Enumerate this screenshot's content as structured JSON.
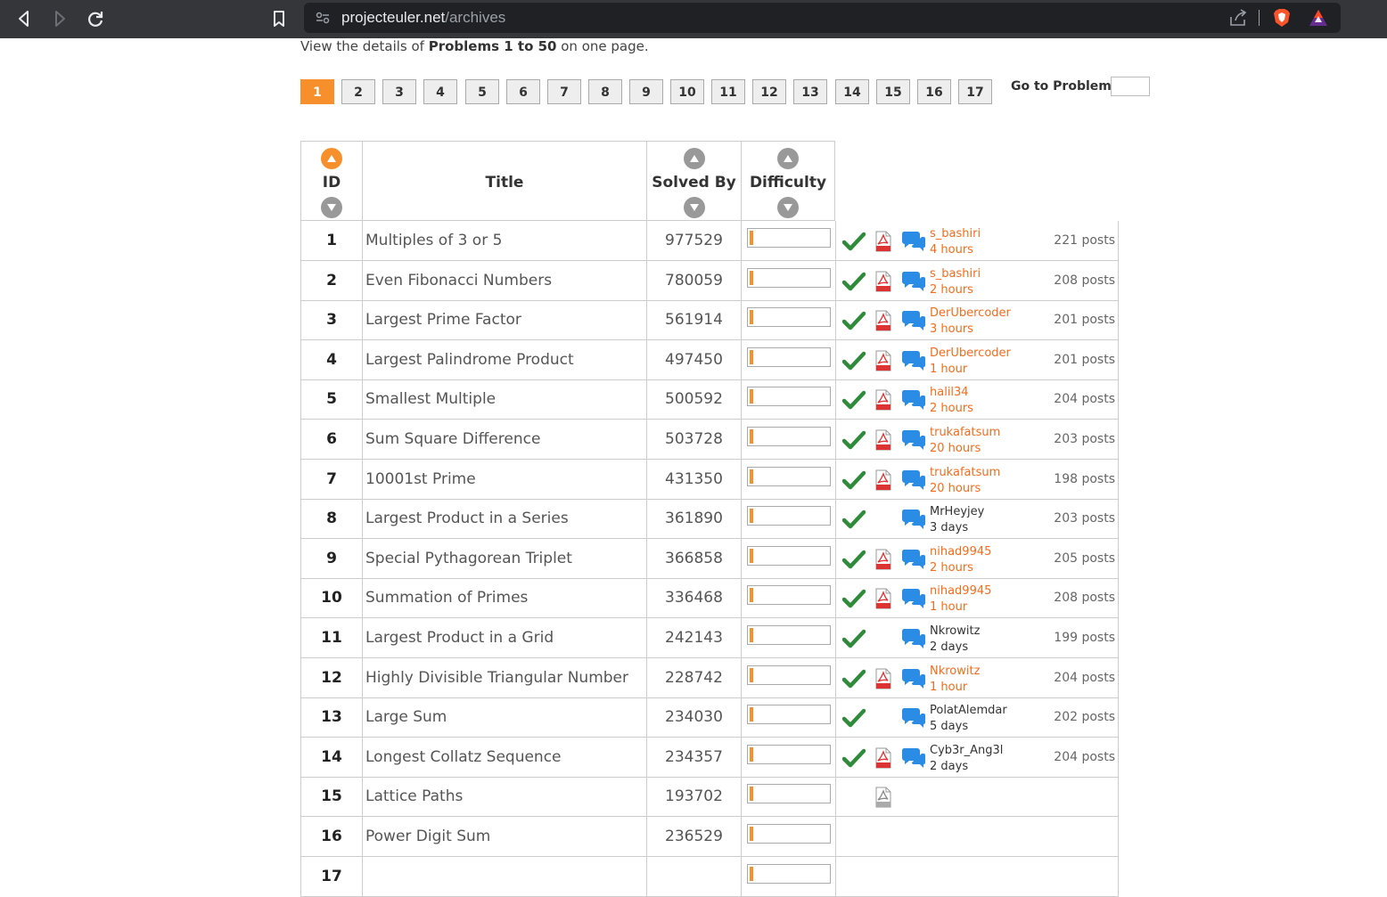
{
  "browser": {
    "url_host": "projecteuler.net",
    "url_path": "/archives"
  },
  "intro": {
    "prefix": "View the details of ",
    "bold": "Problems 1 to 50",
    "suffix": " on one page."
  },
  "pagination": {
    "pages": [
      "1",
      "2",
      "3",
      "4",
      "5",
      "6",
      "7",
      "8",
      "9",
      "10",
      "11",
      "12",
      "13",
      "14",
      "15",
      "16",
      "17"
    ],
    "active": "1",
    "goto_label": "Go to Problem:",
    "accent": "#f7902c"
  },
  "table": {
    "headers": {
      "id": "ID",
      "title": "Title",
      "solved_by": "Solved By",
      "difficulty": "Difficulty"
    },
    "rows": [
      {
        "id": "1",
        "title": "Multiples of 3 or 5",
        "solved": "977529",
        "difficulty": 0.05,
        "solved_mark": true,
        "pdf": true,
        "forum": true,
        "user": "s_bashiri",
        "time": "4 hours",
        "recent": true,
        "posts": "221 posts"
      },
      {
        "id": "2",
        "title": "Even Fibonacci Numbers",
        "solved": "780059",
        "difficulty": 0.05,
        "solved_mark": true,
        "pdf": true,
        "forum": true,
        "user": "s_bashiri",
        "time": "2 hours",
        "recent": true,
        "posts": "208 posts"
      },
      {
        "id": "3",
        "title": "Largest Prime Factor",
        "solved": "561914",
        "difficulty": 0.05,
        "solved_mark": true,
        "pdf": true,
        "forum": true,
        "user": "DerUbercoder",
        "time": "3 hours",
        "recent": true,
        "posts": "201 posts"
      },
      {
        "id": "4",
        "title": "Largest Palindrome Product",
        "solved": "497450",
        "difficulty": 0.05,
        "solved_mark": true,
        "pdf": true,
        "forum": true,
        "user": "DerUbercoder",
        "time": "1 hour",
        "recent": true,
        "posts": "201 posts"
      },
      {
        "id": "5",
        "title": "Smallest Multiple",
        "solved": "500592",
        "difficulty": 0.05,
        "solved_mark": true,
        "pdf": true,
        "forum": true,
        "user": "halil34",
        "time": "2 hours",
        "recent": true,
        "posts": "204 posts"
      },
      {
        "id": "6",
        "title": "Sum Square Difference",
        "solved": "503728",
        "difficulty": 0.05,
        "solved_mark": true,
        "pdf": true,
        "forum": true,
        "user": "trukafatsum",
        "time": "20 hours",
        "recent": true,
        "posts": "203 posts"
      },
      {
        "id": "7",
        "title": "10001st Prime",
        "solved": "431350",
        "difficulty": 0.05,
        "solved_mark": true,
        "pdf": true,
        "forum": true,
        "user": "trukafatsum",
        "time": "20 hours",
        "recent": true,
        "posts": "198 posts"
      },
      {
        "id": "8",
        "title": "Largest Product in a Series",
        "solved": "361890",
        "difficulty": 0.05,
        "solved_mark": true,
        "pdf": false,
        "forum": true,
        "user": "MrHeyjey",
        "time": "3 days",
        "recent": false,
        "posts": "203 posts"
      },
      {
        "id": "9",
        "title": "Special Pythagorean Triplet",
        "solved": "366858",
        "difficulty": 0.05,
        "solved_mark": true,
        "pdf": true,
        "forum": true,
        "user": "nihad9945",
        "time": "2 hours",
        "recent": true,
        "posts": "205 posts"
      },
      {
        "id": "10",
        "title": "Summation of Primes",
        "solved": "336468",
        "difficulty": 0.05,
        "solved_mark": true,
        "pdf": true,
        "forum": true,
        "user": "nihad9945",
        "time": "1 hour",
        "recent": true,
        "posts": "208 posts"
      },
      {
        "id": "11",
        "title": "Largest Product in a Grid",
        "solved": "242143",
        "difficulty": 0.05,
        "solved_mark": true,
        "pdf": false,
        "forum": true,
        "user": "Nkrowitz",
        "time": "2 days",
        "recent": false,
        "posts": "199 posts"
      },
      {
        "id": "12",
        "title": "Highly Divisible Triangular Number",
        "solved": "228742",
        "difficulty": 0.05,
        "solved_mark": true,
        "pdf": true,
        "forum": true,
        "user": "Nkrowitz",
        "time": "1 hour",
        "recent": true,
        "posts": "204 posts"
      },
      {
        "id": "13",
        "title": "Large Sum",
        "solved": "234030",
        "difficulty": 0.05,
        "solved_mark": true,
        "pdf": false,
        "forum": true,
        "user": "PolatAlemdar",
        "time": "5 days",
        "recent": false,
        "posts": "202 posts"
      },
      {
        "id": "14",
        "title": "Longest Collatz Sequence",
        "solved": "234357",
        "difficulty": 0.05,
        "solved_mark": true,
        "pdf": true,
        "forum": true,
        "user": "Cyb3r_Ang3l",
        "time": "2 days",
        "recent": false,
        "posts": "204 posts"
      },
      {
        "id": "15",
        "title": "Lattice Paths",
        "solved": "193702",
        "difficulty": 0.05,
        "solved_mark": false,
        "pdf": "grey",
        "forum": false,
        "user": "",
        "time": "",
        "recent": false,
        "posts": ""
      },
      {
        "id": "16",
        "title": "Power Digit Sum",
        "solved": "236529",
        "difficulty": 0.05,
        "solved_mark": false,
        "pdf": false,
        "forum": false,
        "user": "",
        "time": "",
        "recent": false,
        "posts": ""
      },
      {
        "id": "17",
        "title": "",
        "solved": "",
        "difficulty": 0.05,
        "solved_mark": false,
        "pdf": false,
        "forum": false,
        "user": "",
        "time": "",
        "recent": false,
        "posts": ""
      }
    ]
  }
}
